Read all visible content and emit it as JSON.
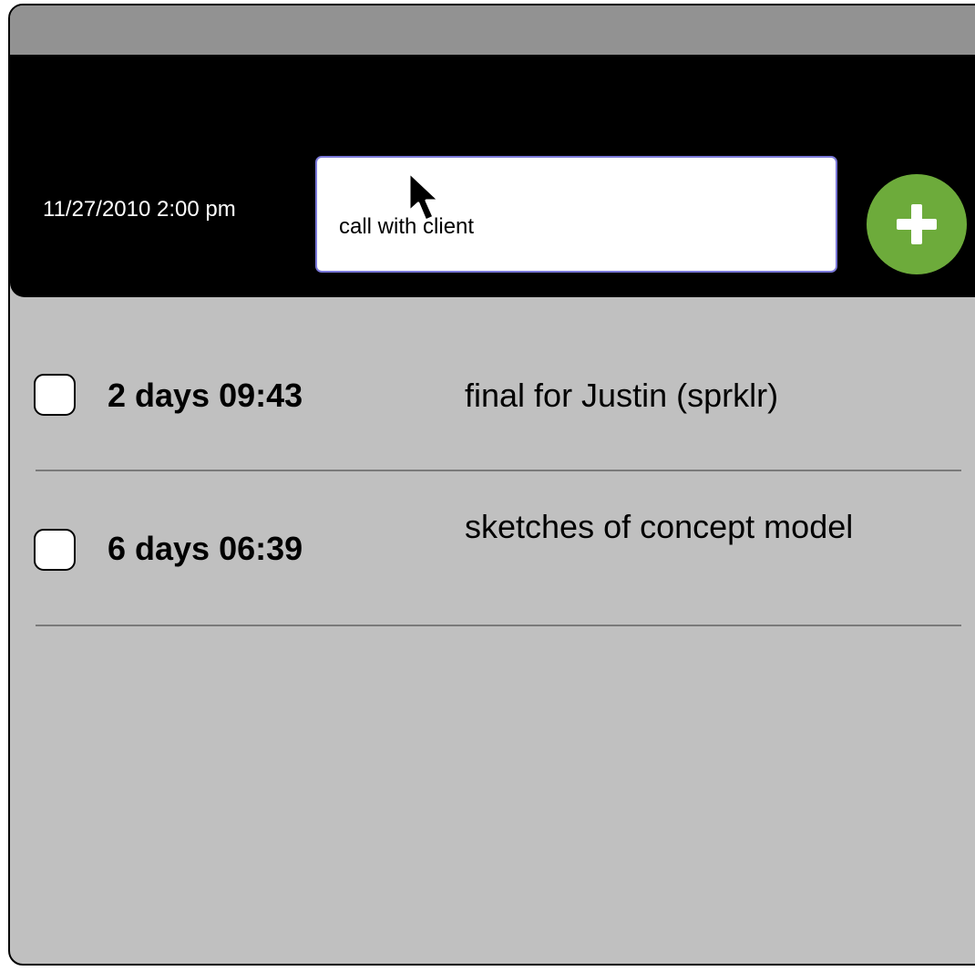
{
  "header": {
    "datetime": "11/27/2010 2:00 pm",
    "task_input_value": "call with client",
    "add_button_icon": "plus-icon",
    "add_button_color": "#6dab3b"
  },
  "tasks": [
    {
      "time": "2 days 09:43",
      "description": "final for Justin (sprklr)",
      "checked": false
    },
    {
      "time": "6 days 06:39",
      "description": "sketches of concept model",
      "checked": false
    }
  ],
  "colors": {
    "titlebar": "#929292",
    "header_background": "#000000",
    "list_background": "#c0c0c0",
    "input_border": "#7a78d8"
  }
}
